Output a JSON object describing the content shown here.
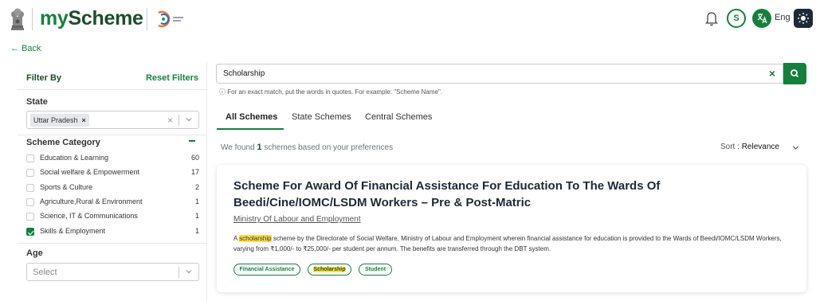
{
  "header": {
    "logo_my": "my",
    "logo_scheme": "Scheme",
    "user_initial": "S",
    "language": "Eng"
  },
  "back_label": "← Back",
  "sidebar": {
    "filter_by": "Filter By",
    "reset_filters": "Reset Filters",
    "state_label": "State",
    "state_chip": "Uttar Pradesh",
    "scheme_category_label": "Scheme Category",
    "categories": [
      {
        "label": "Education & Learning",
        "count": "60",
        "checked": false
      },
      {
        "label": "Social welfare & Empowerment",
        "count": "17",
        "checked": false
      },
      {
        "label": "Sports & Culture",
        "count": "2",
        "checked": false
      },
      {
        "label": "Agriculture,Rural & Environment",
        "count": "1",
        "checked": false
      },
      {
        "label": "Science, IT & Communications",
        "count": "1",
        "checked": false
      },
      {
        "label": "Skills & Employment",
        "count": "1",
        "checked": true
      }
    ],
    "age_label": "Age",
    "age_placeholder": "Select"
  },
  "search": {
    "value": "Scholarship",
    "hint": "ⓘ For an exact match, put the words in quotes. For example: \"Scheme Name\"."
  },
  "tabs": [
    "All Schemes",
    "State Schemes",
    "Central Schemes"
  ],
  "results": {
    "found_prefix": "We found",
    "found_count": "1",
    "found_suffix": "schemes based on your preferences",
    "sort_label": "Sort :",
    "sort_value": "Relevance"
  },
  "card": {
    "title": "Scheme For Award Of Financial Assistance For Education To The Wards Of Beedi/Cine/IOMC/LSDM Workers – Pre & Post-Matric",
    "ministry": "Ministry Of Labour and Employment",
    "desc_pre": "A ",
    "desc_highlight": "scholarship",
    "desc_post": " scheme by the Directorate of Social Welfare, Ministry of Labour and Employment wherein financial assistance for education is provided to the Wards of Beedi/IOMC/LSDM Workers, varying from ₹1,000/- to ₹25,000/- per student per annum. The benefits are transferred through the DBT system.",
    "tags": [
      "Financial Assistance",
      "Scholarship",
      "Student"
    ]
  },
  "colors": {
    "brand_green": "#15803d",
    "dark_green": "#1e4d2b",
    "highlight": "#fde047"
  }
}
